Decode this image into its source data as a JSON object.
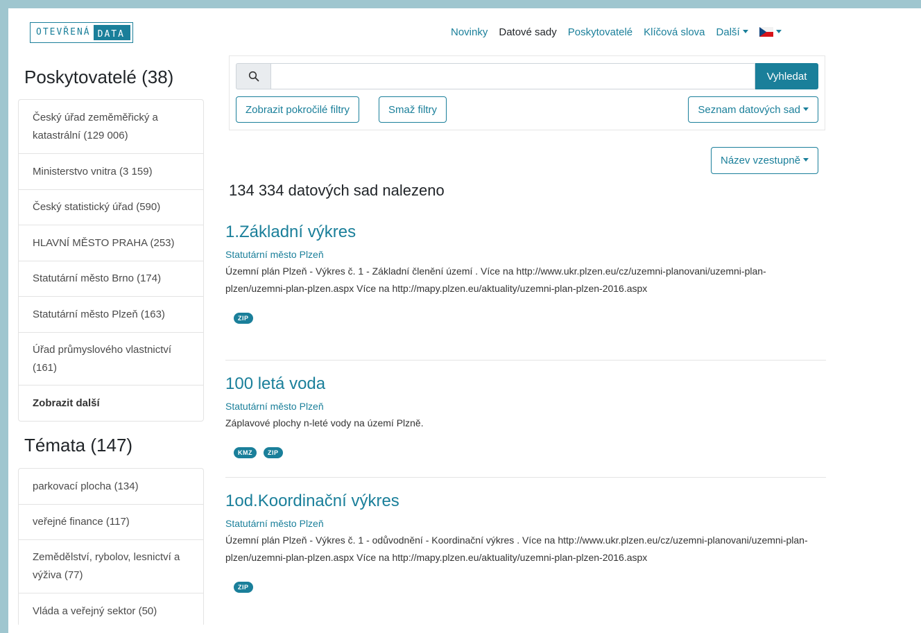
{
  "logo": {
    "part1": "OTEVŘENÁ",
    "part2": "DATA"
  },
  "nav": {
    "items": [
      "Novinky",
      "Datové sady",
      "Poskytovatelé",
      "Klíčová slova",
      "Další"
    ],
    "language_icon": "czech-flag-icon"
  },
  "providers": {
    "heading": "Poskytovatelé (38)",
    "items": [
      "Český úřad zeměměřický a katastrální (129 006)",
      "Ministerstvo vnitra (3 159)",
      "Český statistický úřad (590)",
      "HLAVNÍ MĚSTO PRAHA (253)",
      "Statutární město Brno (174)",
      "Statutární město Plzeň (163)",
      "Úřad průmyslového vlastnictví (161)"
    ],
    "show_more": "Zobrazit další"
  },
  "topics": {
    "heading": "Témata (147)",
    "items": [
      "parkovací plocha (134)",
      "veřejné finance (117)",
      "Zemědělství, rybolov, lesnictví a výživa (77)",
      "Vláda a veřejný sektor (50)"
    ]
  },
  "search": {
    "value": "",
    "button": "Vyhledat",
    "advanced_filters": "Zobrazit pokročilé filtry",
    "clear_filters": "Smaž filtry",
    "view_mode": "Seznam datových sad"
  },
  "sort": {
    "label": "Název vzestupně"
  },
  "results": {
    "count_text": "134 334 datových sad nalezeno",
    "items": [
      {
        "title": "1.Základní výkres",
        "provider": "Statutární město Plzeň",
        "description": "Územní plán Plzeň - Výkres č. 1 - Základní členění území . Více na http://www.ukr.plzen.eu/cz/uzemni-planovani/uzemni-plan-plzen/uzemni-plan-plzen.aspx Více na http://mapy.plzen.eu/aktuality/uzemni-plan-plzen-2016.aspx",
        "formats": [
          "ZIP"
        ]
      },
      {
        "title": "100 letá voda",
        "provider": "Statutární město Plzeň",
        "description": "Záplavové plochy n-leté vody na území Plzně.",
        "formats": [
          "KMZ",
          "ZIP"
        ]
      },
      {
        "title": "1od.Koordinační výkres",
        "provider": "Statutární město Plzeň",
        "description": "Územní plán Plzeň - Výkres č. 1 - odůvodnění - Koordinační výkres . Více na http://www.ukr.plzen.eu/cz/uzemni-planovani/uzemni-plan-plzen/uzemni-plan-plzen.aspx Více na http://mapy.plzen.eu/aktuality/uzemni-plan-plzen-2016.aspx",
        "formats": [
          "ZIP"
        ]
      }
    ]
  },
  "colors": {
    "accent": "#1a7f9a",
    "frame": "#9fc6cf"
  }
}
